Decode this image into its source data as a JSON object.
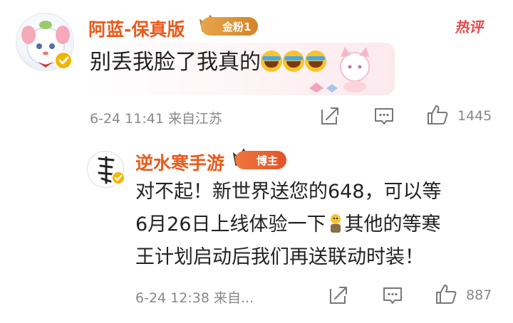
{
  "comment": {
    "username": "阿蓝-保真版",
    "fan_badge": "金粉1",
    "hot_label": "热评",
    "text": "别丢我脸了我真的",
    "emoji_names": [
      "crying-laughing-emoji",
      "crying-laughing-emoji",
      "crying-laughing-emoji"
    ],
    "date": "6-24",
    "time": "11:41",
    "source": "来自江苏",
    "like_count": "1445"
  },
  "reply": {
    "username": "逆水寒手游",
    "role_badge": "博主",
    "line1": "对不起！新世界送您的648，可以等",
    "line2_before": "6月26日上线体验一下",
    "line2_after": "其他的等寒",
    "line3": "王计划启动后我们再送联动时装！",
    "date": "6-24",
    "time": "12:38",
    "source": "来自...",
    "like_count": "887"
  },
  "colors": {
    "username": "#ea5a1a",
    "meta": "#888888",
    "hot": "#e8484a",
    "verified": "#f2b600"
  },
  "icons": [
    "share-icon",
    "comment-icon",
    "like-icon",
    "verified-icon",
    "crown-icon"
  ]
}
